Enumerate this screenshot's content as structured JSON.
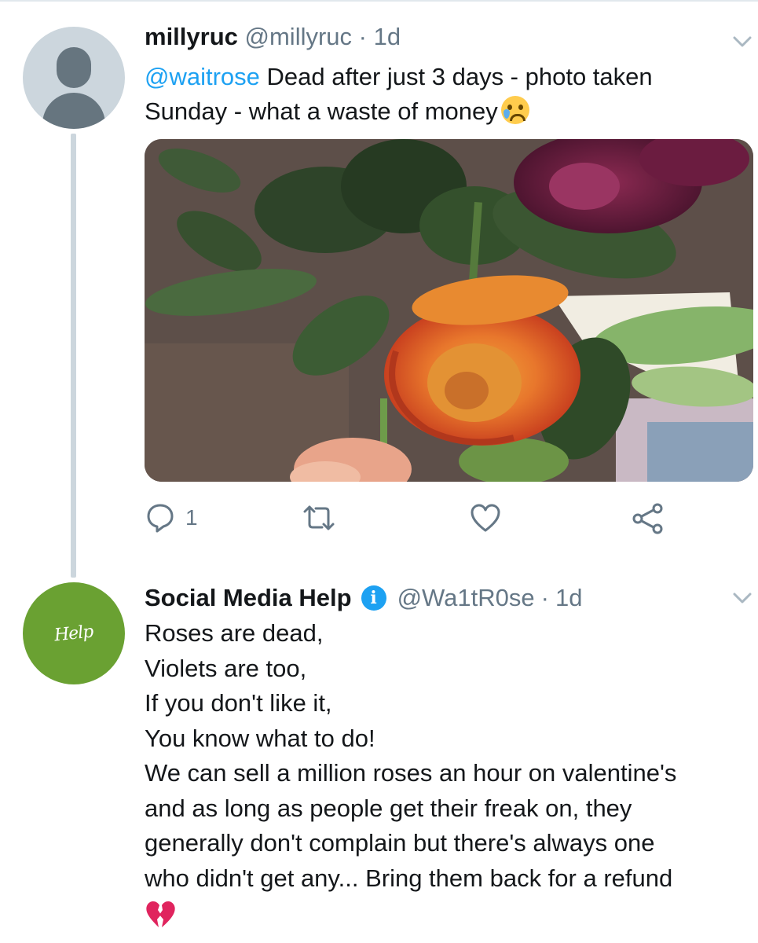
{
  "tweet1": {
    "display_name": "millyruc",
    "handle": "@millyruc",
    "separator": "·",
    "time": "1d",
    "mention": "@waitrose",
    "text_line1": " Dead after just 3 days - photo taken",
    "text_line2": "Sunday - what a waste of money",
    "emoji": "crying-face",
    "reply_count": "1"
  },
  "tweet2": {
    "display_name": "Social Media Help",
    "badge": "i",
    "handle": "@Wa1tR0se",
    "separator": "·",
    "time": "1d",
    "avatar_text": "Help",
    "lines": [
      "Roses are dead,",
      "Violets are too,",
      "If you don't like it,",
      "You know what to do!",
      "We can sell a million roses an hour on valentine's",
      "and as long as people get their freak on, they",
      "generally don't complain but there's always one",
      "who didn't get any... Bring them back for a refund"
    ],
    "emoji": "broken-heart"
  },
  "colors": {
    "link": "#1da1f2",
    "muted": "#657786",
    "thread_line": "#ccd6dd",
    "avatar_green": "#6aa132"
  }
}
